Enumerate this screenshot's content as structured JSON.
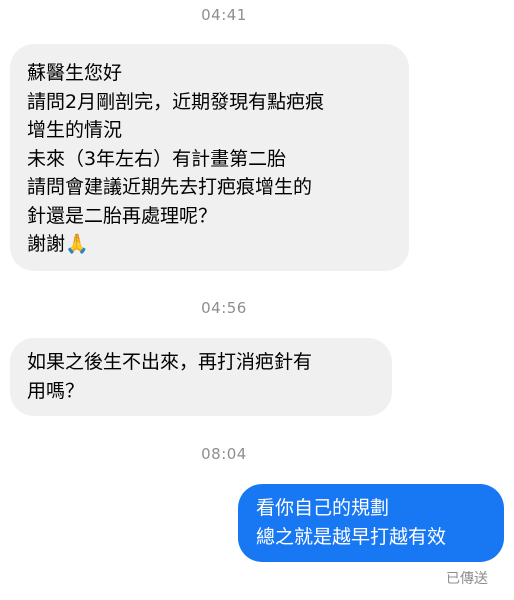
{
  "conversation": {
    "timestamp_1": "04:41",
    "message_1": {
      "lines": [
        "蘇醫生您好",
        "請問2月剛剖完，近期發現有點疤痕",
        "增生的情況",
        "未來（3年左右）有計畫第二胎",
        "請問會建議近期先去打疤痕增生的",
        "針還是二胎再處理呢？",
        "謝謝🙏"
      ]
    },
    "timestamp_2": "04:56",
    "message_2": {
      "lines": [
        "如果之後生不出來，再打消疤針有",
        "用嗎？"
      ]
    },
    "timestamp_3": "08:04",
    "message_3": {
      "lines": [
        "看你自己的規劃",
        "總之就是越早打越有效"
      ]
    },
    "delivery_status": "已傳送"
  },
  "colors": {
    "incoming_bubble": "#f0f0f0",
    "outgoing_bubble": "#1877f2",
    "timestamp_text": "#8e8e93"
  }
}
